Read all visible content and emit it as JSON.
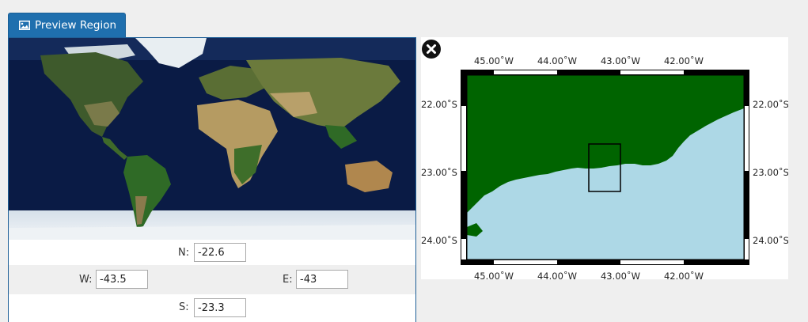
{
  "preview_button": {
    "label": "Preview Region",
    "icon": "image-icon"
  },
  "coords": {
    "n_label": "N:",
    "n_value": "-22.6",
    "w_label": "W:",
    "w_value": "-43.5",
    "e_label": "E:",
    "e_value": "-43",
    "s_label": "S:",
    "s_value": "-23.3"
  },
  "region_map": {
    "close_icon": "close-icon",
    "x_ticks": [
      "45.00˚W",
      "44.00˚W",
      "43.00˚W",
      "42.00˚W"
    ],
    "y_ticks": [
      "22.00˚S",
      "23.00˚S",
      "24.00˚S"
    ],
    "colors": {
      "land": "#006400",
      "water": "#add8e6",
      "frame": "#000000"
    }
  }
}
